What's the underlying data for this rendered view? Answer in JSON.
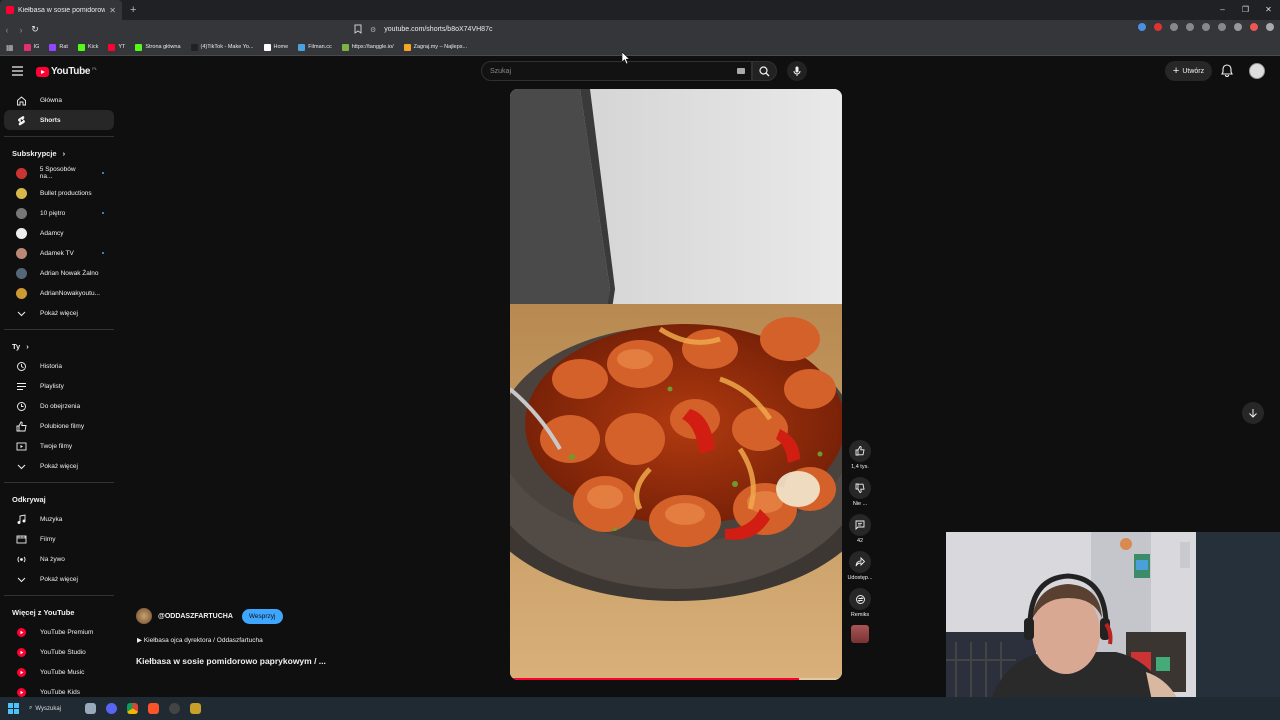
{
  "browser": {
    "tab_title": "Kiełbasa w sosie pomidorowo",
    "url": "youtube.com/shorts/b8oX74VH87c",
    "bookmarks": [
      {
        "label": "IG",
        "color": "#e1306c"
      },
      {
        "label": "Rat",
        "color": "#9146ff"
      },
      {
        "label": "Kick",
        "color": "#53fc18"
      },
      {
        "label": "YT",
        "color": "#ff0033"
      },
      {
        "label": "Strona główna",
        "color": "#53fc18"
      },
      {
        "label": "(4)TikTok - Make Yo...",
        "color": "#222222"
      },
      {
        "label": "Home",
        "color": "#ffffff"
      },
      {
        "label": "Filman.cc",
        "color": "#4aa3df"
      },
      {
        "label": "https://tanggle.io/",
        "color": "#7cb342"
      },
      {
        "label": "Zagraj.my – Najleps...",
        "color": "#f5a623"
      }
    ]
  },
  "header": {
    "logo_text": "YouTube",
    "logo_region": "PL",
    "search_placeholder": "Szukaj",
    "create_label": "Utwórz"
  },
  "sidebar": {
    "main": [
      {
        "label": "Główna",
        "icon": "home-icon"
      },
      {
        "label": "Shorts",
        "icon": "shorts-icon",
        "active": true
      }
    ],
    "subscriptions_title": "Subskrypcje",
    "subscriptions": [
      {
        "label": "5 Sposobów na...",
        "color": "#c33",
        "live": true
      },
      {
        "label": "Bullet productions",
        "color": "#d8b84a",
        "live": false
      },
      {
        "label": "10 piętro",
        "color": "#777",
        "live": true
      },
      {
        "label": "Adamcy",
        "color": "#eee",
        "live": false
      },
      {
        "label": "Adamek TV",
        "color": "#b87",
        "live": true
      },
      {
        "label": "Adrian Nowak Żalno",
        "color": "#567",
        "live": false
      },
      {
        "label": "AdrianNowakyoutu...",
        "color": "#c93",
        "live": false
      }
    ],
    "show_more": "Pokaż więcej",
    "you_title": "Ty",
    "you": [
      {
        "label": "Historia",
        "icon": "history-icon"
      },
      {
        "label": "Playlisty",
        "icon": "playlist-icon"
      },
      {
        "label": "Do obejrzenia",
        "icon": "clock-icon"
      },
      {
        "label": "Polubione filmy",
        "icon": "thumb-up-icon"
      },
      {
        "label": "Twoje filmy",
        "icon": "video-icon"
      },
      {
        "label": "Pokaż więcej",
        "icon": "chevron-down-icon"
      }
    ],
    "explore_title": "Odkrywaj",
    "explore": [
      {
        "label": "Muzyka",
        "icon": "music-icon"
      },
      {
        "label": "Filmy",
        "icon": "film-icon"
      },
      {
        "label": "Na żywo",
        "icon": "live-icon"
      },
      {
        "label": "Pokaż więcej",
        "icon": "chevron-down-icon"
      }
    ],
    "more_title": "Więcej z YouTube",
    "more": [
      {
        "label": "YouTube Premium"
      },
      {
        "label": "YouTube Studio"
      },
      {
        "label": "YouTube Music"
      },
      {
        "label": "YouTube Kids"
      }
    ]
  },
  "short": {
    "channel": "@ODDASZFARTUCHA",
    "support_label": "Wesprzyj",
    "playlist": "Kiełbasa ojca dyrektora / Oddaszfartucha",
    "title": "Kiełbasa w sosie pomidorowo paprykowym / ...",
    "progress": 0.87,
    "likes": "1,4 tys.",
    "dislike_label": "Nie ...",
    "comments": "42",
    "share_label": "Udostęp...",
    "remix_label": "Remiks"
  },
  "taskbar": {
    "search_label": "Wyszukaj"
  }
}
